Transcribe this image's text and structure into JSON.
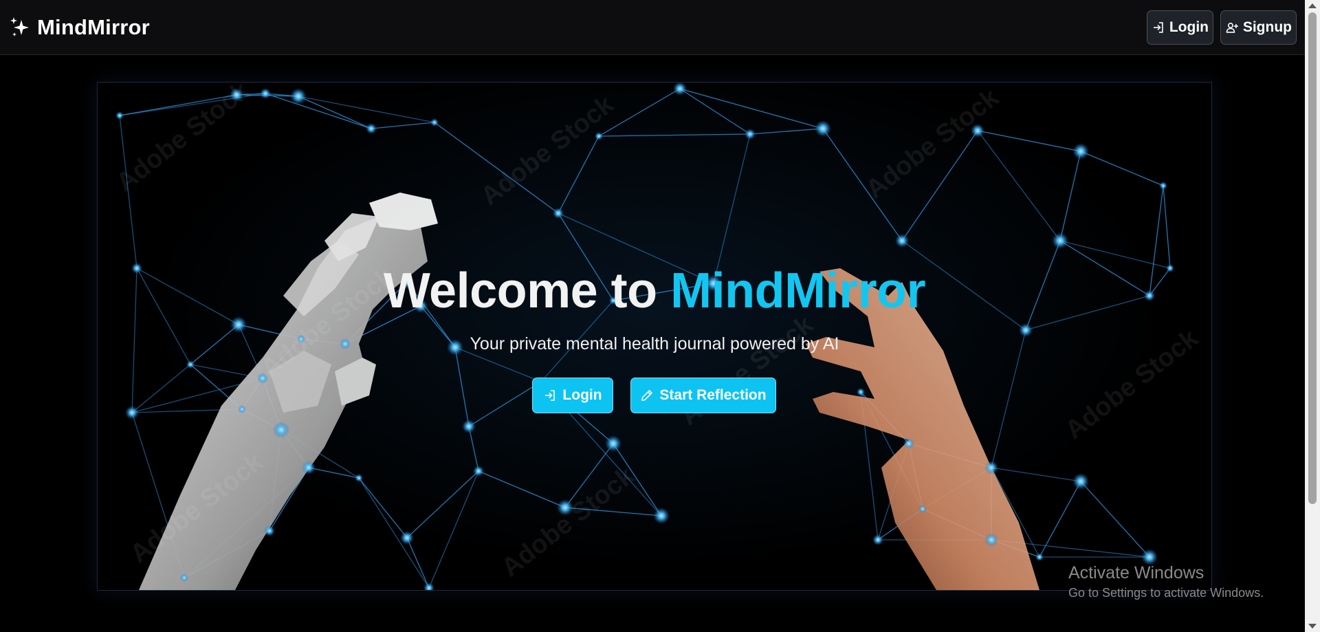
{
  "header": {
    "brand": "MindMirror",
    "login_label": "Login",
    "signup_label": "Signup"
  },
  "hero": {
    "title_prefix": "Welcome to ",
    "title_accent": "MindMirror",
    "subtitle": "Your private mental health journal powered by AI",
    "login_label": "Login",
    "start_label": "Start Reflection",
    "stock_watermark": "Adobe Stock"
  },
  "os_watermark": {
    "title": "Activate Windows",
    "subtitle": "Go to Settings to activate Windows."
  },
  "colors": {
    "accent": "#13c6f0",
    "cta_bg": "#0dc3f2",
    "topbar_bg": "#0d0d0f",
    "node": "#4fc3ff"
  },
  "icons": {
    "brand": "sparkles-icon",
    "login": "login-arrow-icon",
    "signup": "user-plus-icon",
    "start": "pencil-icon"
  }
}
